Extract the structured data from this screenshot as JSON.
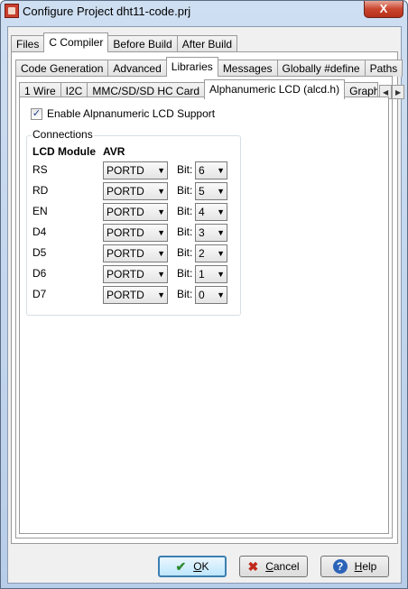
{
  "window": {
    "title": "Configure Project dht11-code.prj",
    "close_label": "X"
  },
  "tabs_main": [
    "Files",
    "C Compiler",
    "Before Build",
    "After Build"
  ],
  "tabs_compiler": [
    "Code Generation",
    "Advanced",
    "Libraries",
    "Messages",
    "Globally #define",
    "Paths"
  ],
  "tabs_libraries": [
    "1 Wire",
    "I2C",
    "MMC/SD/SD HC Card",
    "Alphanumeric LCD (alcd.h)",
    "Graph"
  ],
  "enable_checkbox": {
    "label": "Enable Alpnanumeric LCD Support",
    "checked": true,
    "mark": "✓"
  },
  "connections": {
    "group_label": "Connections",
    "header_module": "LCD Module",
    "header_avr": "AVR",
    "bit_label": "Bit:",
    "rows": [
      {
        "pin": "RS",
        "port": "PORTD",
        "bit": "6"
      },
      {
        "pin": "RD",
        "port": "PORTD",
        "bit": "5"
      },
      {
        "pin": "EN",
        "port": "PORTD",
        "bit": "4"
      },
      {
        "pin": "D4",
        "port": "PORTD",
        "bit": "3"
      },
      {
        "pin": "D5",
        "port": "PORTD",
        "bit": "2"
      },
      {
        "pin": "D6",
        "port": "PORTD",
        "bit": "1"
      },
      {
        "pin": "D7",
        "port": "PORTD",
        "bit": "0"
      }
    ]
  },
  "buttons": {
    "ok": {
      "mnemonic": "O",
      "rest": "K",
      "icon": "✔"
    },
    "cancel": {
      "mnemonic": "C",
      "rest": "ancel",
      "icon": "✖"
    },
    "help": {
      "mnemonic": "H",
      "rest": "elp",
      "icon": "?"
    }
  },
  "colors": {
    "ok_icon": "#2e8b2e",
    "cancel_icon": "#c0281b",
    "help_icon": "#2b63b8"
  }
}
